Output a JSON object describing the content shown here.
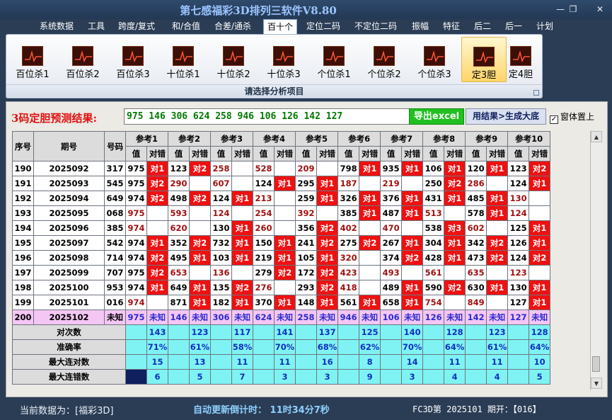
{
  "window": {
    "title": "第七感福彩3D排列三软件V8.80",
    "buttons": [
      "—",
      "❐",
      "✕"
    ]
  },
  "menu": [
    "系统数据",
    "工具",
    "跨度/复式",
    "和/合值",
    "合差/通杀",
    "百十个",
    "定位二码",
    "不定位二码",
    "振幅",
    "特征",
    "后二",
    "后一",
    "计划"
  ],
  "menu_active": "百十个",
  "ribbon": {
    "buttons": [
      "百位杀1",
      "百位杀2",
      "百位杀3",
      "十位杀1",
      "十位杀2",
      "十位杀3",
      "个位杀1",
      "个位杀2",
      "个位杀3",
      "定3胆",
      "定4胆"
    ],
    "selected": "定3胆",
    "icon": "chart-line-icon",
    "caption": "请选择分析项目"
  },
  "prediction": {
    "label": "3码定胆预测结果:",
    "value": "975 146 306 624 258 946 106 126 142 127",
    "export_label": "导出excel",
    "generate_label": "用结果>生成大底",
    "topmost_label": "窗体置上",
    "topmost_checked": true
  },
  "table": {
    "headers": {
      "seq": "序号",
      "issue": "期号",
      "number": "号码"
    },
    "refs": [
      "参考1",
      "参考2",
      "参考3",
      "参考4",
      "参考5",
      "参考6",
      "参考7",
      "参考8",
      "参考9",
      "参考10"
    ],
    "sub_headers": [
      "值",
      "对错"
    ],
    "rows": [
      {
        "seq": "190",
        "issue": "2025092",
        "num": "317",
        "cells": [
          [
            "975",
            "对1"
          ],
          [
            "123",
            "对2"
          ],
          [
            "258",
            ""
          ],
          [
            "528",
            ""
          ],
          [
            "209",
            ""
          ],
          [
            "798",
            "对1"
          ],
          [
            "935",
            "对1"
          ],
          [
            "106",
            "对1"
          ],
          [
            "120",
            "对1"
          ],
          [
            "123",
            "对2"
          ]
        ]
      },
      {
        "seq": "191",
        "issue": "2025093",
        "num": "545",
        "cells": [
          [
            "975",
            "对2"
          ],
          [
            "290",
            ""
          ],
          [
            "607",
            ""
          ],
          [
            "124",
            "对1"
          ],
          [
            "295",
            "对1"
          ],
          [
            "187",
            ""
          ],
          [
            "219",
            ""
          ],
          [
            "250",
            "对2"
          ],
          [
            "286",
            ""
          ],
          [
            "124",
            "对1"
          ]
        ]
      },
      {
        "seq": "192",
        "issue": "2025094",
        "num": "649",
        "cells": [
          [
            "974",
            "对2"
          ],
          [
            "498",
            "对2"
          ],
          [
            "124",
            "对1"
          ],
          [
            "213",
            ""
          ],
          [
            "259",
            "对1"
          ],
          [
            "326",
            "对1"
          ],
          [
            "376",
            "对1"
          ],
          [
            "431",
            "对1"
          ],
          [
            "485",
            "对1"
          ],
          [
            "130",
            ""
          ]
        ]
      },
      {
        "seq": "193",
        "issue": "2025095",
        "num": "068",
        "cells": [
          [
            "975",
            ""
          ],
          [
            "593",
            ""
          ],
          [
            "124",
            ""
          ],
          [
            "254",
            ""
          ],
          [
            "392",
            ""
          ],
          [
            "385",
            "对1"
          ],
          [
            "487",
            "对1"
          ],
          [
            "513",
            ""
          ],
          [
            "578",
            "对1"
          ],
          [
            "124",
            ""
          ]
        ]
      },
      {
        "seq": "194",
        "issue": "2025096",
        "num": "385",
        "cells": [
          [
            "974",
            ""
          ],
          [
            "620",
            ""
          ],
          [
            "130",
            "对1"
          ],
          [
            "260",
            ""
          ],
          [
            "356",
            "对2"
          ],
          [
            "402",
            ""
          ],
          [
            "470",
            ""
          ],
          [
            "538",
            "对3"
          ],
          [
            "602",
            ""
          ],
          [
            "125",
            "对1"
          ]
        ]
      },
      {
        "seq": "195",
        "issue": "2025097",
        "num": "542",
        "cells": [
          [
            "974",
            "对1"
          ],
          [
            "352",
            "对2"
          ],
          [
            "732",
            "对1"
          ],
          [
            "150",
            "对1"
          ],
          [
            "241",
            "对2"
          ],
          [
            "275",
            "对2"
          ],
          [
            "267",
            "对1"
          ],
          [
            "304",
            "对1"
          ],
          [
            "342",
            "对2"
          ],
          [
            "126",
            "对1"
          ]
        ]
      },
      {
        "seq": "196",
        "issue": "2025098",
        "num": "714",
        "cells": [
          [
            "974",
            "对2"
          ],
          [
            "495",
            "对1"
          ],
          [
            "103",
            "对1"
          ],
          [
            "219",
            "对1"
          ],
          [
            "105",
            "对1"
          ],
          [
            "320",
            ""
          ],
          [
            "374",
            "对2"
          ],
          [
            "428",
            "对1"
          ],
          [
            "473",
            "对2"
          ],
          [
            "124",
            "对2"
          ]
        ]
      },
      {
        "seq": "197",
        "issue": "2025099",
        "num": "707",
        "cells": [
          [
            "975",
            "对2"
          ],
          [
            "653",
            ""
          ],
          [
            "136",
            ""
          ],
          [
            "279",
            "对2"
          ],
          [
            "172",
            "对2"
          ],
          [
            "423",
            ""
          ],
          [
            "493",
            ""
          ],
          [
            "561",
            ""
          ],
          [
            "635",
            ""
          ],
          [
            "123",
            ""
          ]
        ]
      },
      {
        "seq": "198",
        "issue": "2025100",
        "num": "953",
        "cells": [
          [
            "974",
            "对1"
          ],
          [
            "649",
            "对1"
          ],
          [
            "135",
            "对2"
          ],
          [
            "276",
            ""
          ],
          [
            "293",
            "对2"
          ],
          [
            "418",
            ""
          ],
          [
            "489",
            "对1"
          ],
          [
            "590",
            "对2"
          ],
          [
            "630",
            "对1"
          ],
          [
            "130",
            "对1"
          ]
        ]
      },
      {
        "seq": "199",
        "issue": "2025101",
        "num": "016",
        "cells": [
          [
            "974",
            ""
          ],
          [
            "871",
            "对1"
          ],
          [
            "182",
            "对1"
          ],
          [
            "370",
            "对1"
          ],
          [
            "148",
            "对1"
          ],
          [
            "561",
            "对1"
          ],
          [
            "658",
            "对1"
          ],
          [
            "754",
            ""
          ],
          [
            "849",
            ""
          ],
          [
            "127",
            "对1"
          ]
        ]
      }
    ],
    "last_row": {
      "seq": "200",
      "issue": "2025102",
      "num": "未知",
      "cells": [
        [
          "975",
          "未知"
        ],
        [
          "146",
          "未知"
        ],
        [
          "306",
          "未知"
        ],
        [
          "624",
          "未知"
        ],
        [
          "258",
          "未知"
        ],
        [
          "946",
          "未知"
        ],
        [
          "106",
          "未知"
        ],
        [
          "126",
          "未知"
        ],
        [
          "142",
          "未知"
        ],
        [
          "127",
          "未知"
        ]
      ]
    },
    "stats": [
      {
        "label": "对次数",
        "values": [
          "143",
          "123",
          "117",
          "141",
          "137",
          "125",
          "140",
          "128",
          "123",
          "128"
        ]
      },
      {
        "label": "准确率",
        "values": [
          "71%",
          "61%",
          "58%",
          "70%",
          "68%",
          "62%",
          "70%",
          "64%",
          "61%",
          "64%"
        ]
      },
      {
        "label": "最大连对数",
        "values": [
          "15",
          "13",
          "11",
          "11",
          "16",
          "8",
          "14",
          "11",
          "11",
          "10"
        ]
      },
      {
        "label": "最大连错数",
        "values": [
          "6",
          "5",
          "7",
          "3",
          "3",
          "9",
          "3",
          "4",
          "4",
          "5"
        ]
      }
    ]
  },
  "status": {
    "current_data": "当前数据为：[福彩3D]",
    "countdown": "自动更新倒计时：  11时34分7秒",
    "issue_info": "FC3D第 2025101 期开：【016】"
  },
  "colors": {
    "hit": "#ee1111",
    "stats_bg": "#7ff3f3",
    "unknown_row_bg": "#f4c6f4",
    "title": "#9cc4ff"
  }
}
